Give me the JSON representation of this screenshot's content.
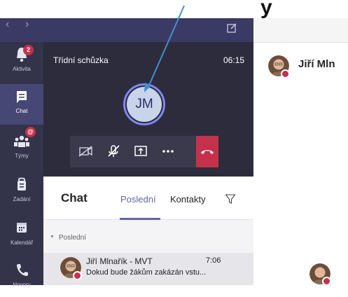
{
  "annotation": {
    "text": "y"
  },
  "rail": {
    "items": [
      {
        "label": "Aktivita",
        "badge": "2",
        "icon": "bell-icon"
      },
      {
        "label": "Chat",
        "icon": "chat-icon"
      },
      {
        "label": "Týmy",
        "badge": "@",
        "icon": "teams-icon"
      },
      {
        "label": "Zadání",
        "icon": "assignments-icon"
      },
      {
        "label": "Kalendář",
        "icon": "calendar-icon"
      },
      {
        "label": "Hovory",
        "icon": "phone-icon"
      }
    ]
  },
  "call": {
    "title": "Třídní schůzka",
    "time": "06:15",
    "initials": "JM",
    "controls": [
      "camera-off-icon",
      "mic-off-icon",
      "share-screen-icon",
      "more-icon",
      "hang-up-icon"
    ]
  },
  "chat": {
    "title": "Chat",
    "tabs": {
      "recent": "Poslední",
      "contacts": "Kontakty"
    },
    "section": "Poslední",
    "rows": [
      {
        "name": "Jiří Mlnařík - MVT",
        "time": "7:06",
        "preview": "Dokud bude žákům zakázán vstu..."
      }
    ]
  },
  "right": {
    "name": "Jiří Mln"
  },
  "colors": {
    "accent": "#6264a7",
    "rail": "#33344a",
    "call_bg": "#2d2c3c",
    "hangup": "#c4314b",
    "arrow": "#3f8fd0"
  }
}
